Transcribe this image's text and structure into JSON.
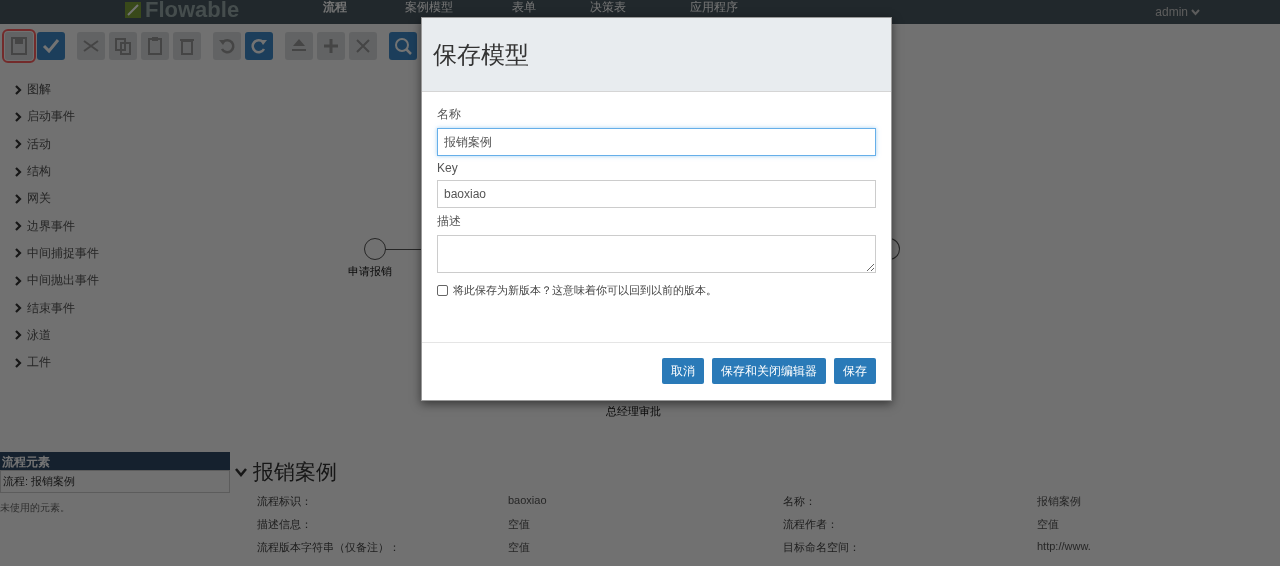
{
  "header": {
    "logo": "Flowable",
    "nav": [
      {
        "label": "流程",
        "selected": true
      },
      {
        "label": "案例模型",
        "selected": false
      },
      {
        "label": "表单",
        "selected": false
      },
      {
        "label": "决策表",
        "selected": false
      },
      {
        "label": "应用程序",
        "selected": false
      }
    ],
    "user": "admin"
  },
  "toolbar": {
    "groups": [
      [
        {
          "kind": "save",
          "highlighted": true
        },
        {
          "kind": "check",
          "highlighted": false
        }
      ],
      [
        {
          "kind": "cut",
          "highlighted": false
        },
        {
          "kind": "copy",
          "highlighted": false
        },
        {
          "kind": "paste",
          "highlighted": false
        },
        {
          "kind": "delete",
          "highlighted": false
        }
      ],
      [
        {
          "kind": "undo",
          "highlighted": false
        },
        {
          "kind": "redo",
          "highlighted": false
        }
      ],
      [
        {
          "kind": "align",
          "highlighted": false
        },
        {
          "kind": "addpoint",
          "highlighted": false
        },
        {
          "kind": "removepoint",
          "highlighted": false
        }
      ],
      [
        {
          "kind": "zoomin",
          "highlighted": false
        }
      ]
    ]
  },
  "palette": [
    {
      "label": "图解",
      "expanded": false
    },
    {
      "label": "启动事件",
      "expanded": false
    },
    {
      "label": "活动",
      "expanded": false
    },
    {
      "label": "结构",
      "expanded": false
    },
    {
      "label": "网关",
      "expanded": false
    },
    {
      "label": "边界事件",
      "expanded": false
    },
    {
      "label": "中间捕捉事件",
      "expanded": false
    },
    {
      "label": "中间抛出事件",
      "expanded": false
    },
    {
      "label": "结束事件",
      "expanded": false
    },
    {
      "label": "泳道",
      "expanded": false
    },
    {
      "label": "工件",
      "expanded": false
    }
  ],
  "canvas": {
    "nodes": [
      {
        "kind": "start",
        "label": "申请报销"
      },
      {
        "kind": "task",
        "label": "总经理审批"
      },
      {
        "kind": "end"
      }
    ]
  },
  "element_panel": {
    "title": "流程元素",
    "row": "流程: 报销案例",
    "note": "未使用的元素。"
  },
  "properties": {
    "title": "报销案例",
    "expanded": true,
    "fields": [
      {
        "label": "流程标识：",
        "value": "baoxiao"
      },
      {
        "label": "名称：",
        "value": "报销案例"
      },
      {
        "label": "描述信息：",
        "value": "空值"
      },
      {
        "label": "流程作者：",
        "value": "空值"
      },
      {
        "label": "流程版本字符串（仅备注）：",
        "value": "空值"
      },
      {
        "label": "目标命名空间：",
        "value": "http://www."
      }
    ]
  },
  "dialog": {
    "title": "保存模型",
    "fields": [
      {
        "kind": "input",
        "label": "名称",
        "value": "报销案例",
        "focused": true
      },
      {
        "kind": "input",
        "label": "Key",
        "value": "baoxiao",
        "focused": false
      },
      {
        "kind": "textarea",
        "label": "描述",
        "focused": false
      }
    ],
    "new_version": {
      "label": "将此保存为新版本？这意味着你可以回到以前的版本。",
      "checked": false
    },
    "buttons": [
      {
        "label": "取消"
      },
      {
        "label": "保存和关闭编辑器"
      },
      {
        "label": "保存"
      }
    ]
  }
}
